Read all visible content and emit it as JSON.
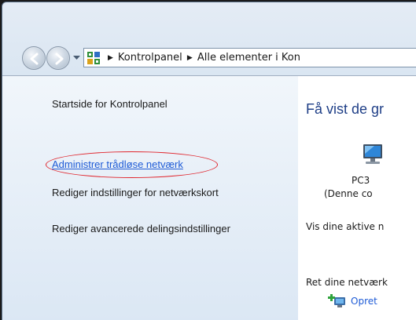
{
  "address": {
    "icon": "control-panel-icon",
    "crumbs": [
      "Kontrolpanel",
      "Alle elementer i Kon"
    ]
  },
  "sidebar": {
    "items": [
      {
        "label": "Startside for Kontrolpanel"
      },
      {
        "label": "Administrer trådløse netværk",
        "highlighted": true
      },
      {
        "label": "Rediger indstillinger for netværkskort"
      },
      {
        "label": "Rediger avancerede delingsindstillinger"
      }
    ]
  },
  "main": {
    "heading": "Få vist de gr",
    "computer_name": "PC3",
    "computer_note": "(Denne co",
    "active_networks_label": "Vis dine aktive n",
    "change_label": "Ret dine netværk",
    "new_connection_link": "Opret"
  },
  "colors": {
    "link": "#1e5bd6",
    "heading": "#1f3f87",
    "annotation_circle": "#e0232b"
  }
}
